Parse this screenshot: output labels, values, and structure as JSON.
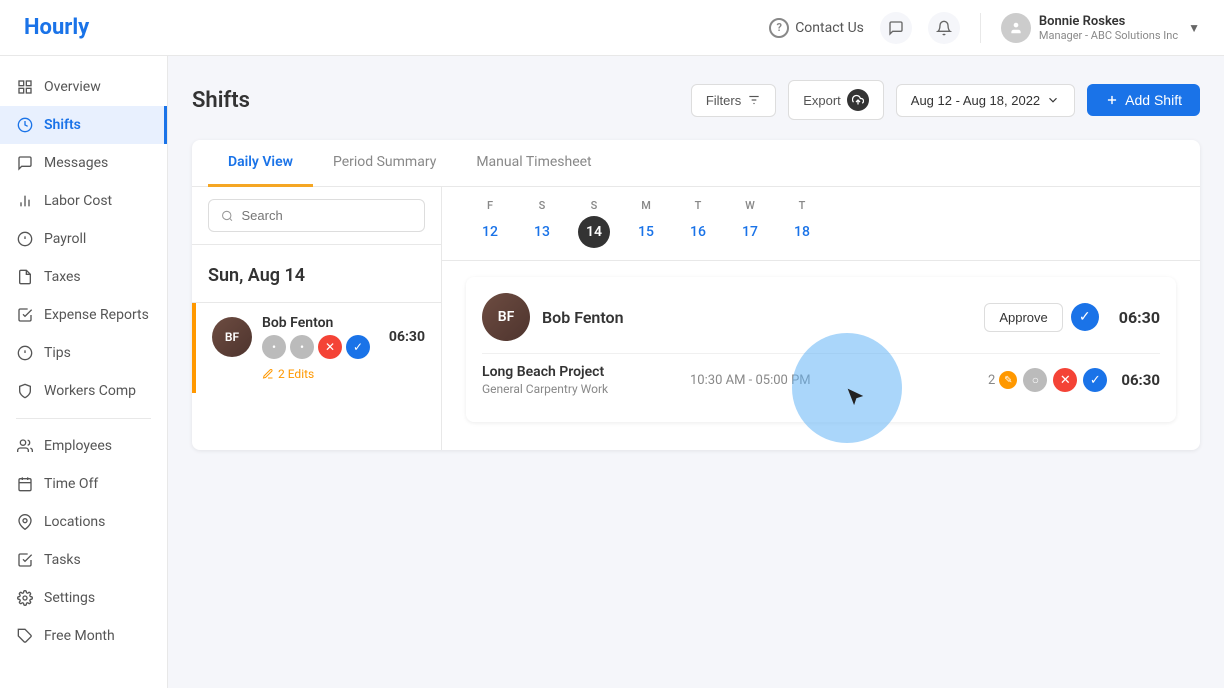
{
  "header": {
    "logo": "Hourly",
    "contact_label": "Contact Us",
    "user_name": "Bonnie Roskes",
    "user_role": "Manager - ABC Solutions Inc"
  },
  "sidebar": {
    "items": [
      {
        "id": "overview",
        "label": "Overview",
        "icon": "⊞",
        "active": false
      },
      {
        "id": "shifts",
        "label": "Shifts",
        "icon": "◷",
        "active": true
      },
      {
        "id": "messages",
        "label": "Messages",
        "icon": "✉",
        "active": false
      },
      {
        "id": "labor-cost",
        "label": "Labor Cost",
        "icon": "📊",
        "active": false
      },
      {
        "id": "payroll",
        "label": "Payroll",
        "icon": "💲",
        "active": false
      },
      {
        "id": "taxes",
        "label": "Taxes",
        "icon": "🧾",
        "active": false
      },
      {
        "id": "expense-reports",
        "label": "Expense Reports",
        "icon": "📋",
        "active": false
      },
      {
        "id": "tips",
        "label": "Tips",
        "icon": "💡",
        "active": false
      },
      {
        "id": "workers-comp",
        "label": "Workers Comp",
        "icon": "🛡",
        "active": false
      },
      {
        "id": "employees",
        "label": "Employees",
        "icon": "👤",
        "active": false
      },
      {
        "id": "time-off",
        "label": "Time Off",
        "icon": "📅",
        "active": false
      },
      {
        "id": "locations",
        "label": "Locations",
        "icon": "📍",
        "active": false
      },
      {
        "id": "tasks",
        "label": "Tasks",
        "icon": "☑",
        "active": false
      },
      {
        "id": "settings",
        "label": "Settings",
        "icon": "⚙",
        "active": false
      },
      {
        "id": "free-month",
        "label": "Free Month",
        "icon": "🏷",
        "active": false
      }
    ]
  },
  "page": {
    "title": "Shifts",
    "filters_label": "Filters",
    "export_label": "Export",
    "date_range": "Aug 12 - Aug 18, 2022",
    "add_shift_label": "Add Shift"
  },
  "tabs": [
    {
      "id": "daily",
      "label": "Daily View",
      "active": true
    },
    {
      "id": "period",
      "label": "Period Summary",
      "active": false
    },
    {
      "id": "manual",
      "label": "Manual Timesheet",
      "active": false
    }
  ],
  "search": {
    "placeholder": "Search"
  },
  "calendar": {
    "selected_date": "Sun, Aug 14",
    "days": [
      {
        "letter": "F",
        "num": "12",
        "active": false
      },
      {
        "letter": "S",
        "num": "13",
        "active": false
      },
      {
        "letter": "S",
        "num": "14",
        "active": true
      },
      {
        "letter": "M",
        "num": "15",
        "active": false
      },
      {
        "letter": "T",
        "num": "16",
        "active": false
      },
      {
        "letter": "W",
        "num": "17",
        "active": false
      },
      {
        "letter": "T",
        "num": "18",
        "active": false
      }
    ]
  },
  "employee_panel": {
    "name": "Bob Fenton",
    "duration": "06:30",
    "edits": "2 Edits"
  },
  "shift_card": {
    "employee_name": "Bob Fenton",
    "approve_label": "Approve",
    "total_duration": "06:30",
    "project_name": "Long Beach Project",
    "project_role": "General Carpentry Work",
    "time_range": "10:30 AM - 05:00 PM",
    "edit_count": "2",
    "row_duration": "06:30"
  }
}
